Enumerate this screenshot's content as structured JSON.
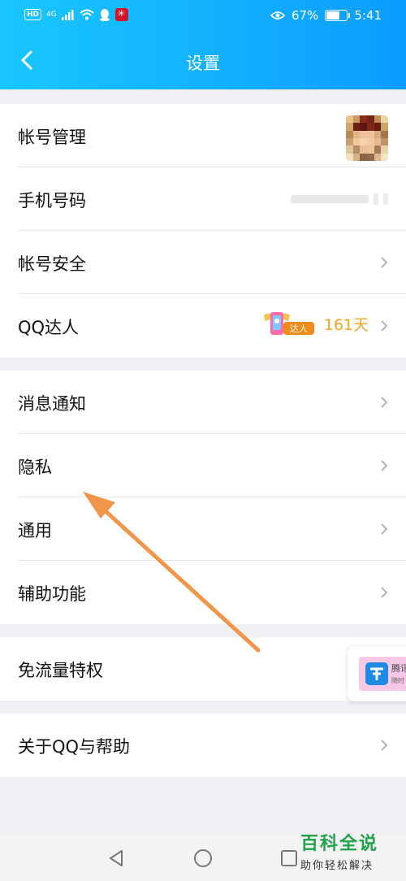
{
  "status_bar": {
    "hd": "HD",
    "network": "4G",
    "battery_percent": "67%",
    "battery_level": 0.67,
    "time": "5:41",
    "icons": [
      "signal-icon",
      "wifi-icon",
      "qq-icon",
      "red-app-icon",
      "eye-icon",
      "battery-icon"
    ]
  },
  "header": {
    "title": "设置",
    "back_icon": "chevron-left-icon"
  },
  "groups": [
    {
      "rows": [
        {
          "label": "帐号管理",
          "accessory": "avatar"
        },
        {
          "label": "手机号码",
          "accessory": "blurred-phone"
        },
        {
          "label": "帐号安全",
          "accessory": "chevron"
        },
        {
          "label": "QQ达人",
          "accessory": "talent",
          "badge_text": "达人",
          "days": "161天"
        }
      ]
    },
    {
      "rows": [
        {
          "label": "消息通知",
          "accessory": "chevron"
        },
        {
          "label": "隐私",
          "accessory": "chevron"
        },
        {
          "label": "通用",
          "accessory": "chevron"
        },
        {
          "label": "辅助功能",
          "accessory": "chevron"
        }
      ]
    },
    {
      "rows": [
        {
          "label": "免流量特权",
          "accessory": "none"
        }
      ]
    },
    {
      "rows": [
        {
          "label": "关于QQ与帮助",
          "accessory": "chevron"
        }
      ]
    }
  ],
  "ad_card": {
    "title": "腾讯",
    "subtitle": "随时"
  },
  "annotation": {
    "color": "#f0964a"
  },
  "system_nav": {
    "icons": [
      "back-triangle-icon",
      "home-circle-icon",
      "recents-square-icon"
    ]
  },
  "watermark": {
    "title": "百科全说",
    "subtitle": "助你轻松解决"
  },
  "colors": {
    "header_gradient_start": "#19c6ff",
    "header_gradient_end": "#0a9cff",
    "background": "#efeff4",
    "talent_orange": "#f0a623"
  }
}
